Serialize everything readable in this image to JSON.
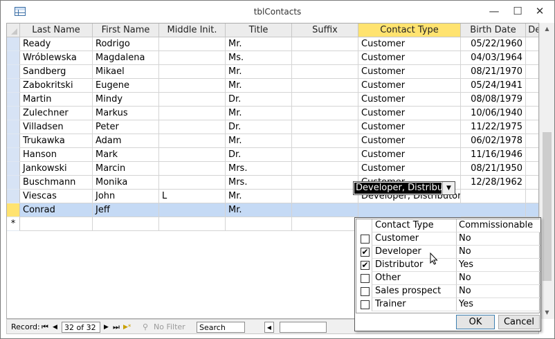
{
  "window": {
    "title": "tblContacts",
    "minimize": "—",
    "maximize": "☐",
    "close": "✕"
  },
  "columns": [
    "Last Name",
    "First Name",
    "Middle Init.",
    "Title",
    "Suffix",
    "Contact Type",
    "Birth Date",
    "Def"
  ],
  "rows": [
    [
      "Ready",
      "Rodrigo",
      "",
      "Mr.",
      "",
      "Customer",
      "05/22/1960"
    ],
    [
      "Wróblewska",
      "Magdalena",
      "",
      "Ms.",
      "",
      "Customer",
      "04/03/1964"
    ],
    [
      "Sandberg",
      "Mikael",
      "",
      "Mr.",
      "",
      "Customer",
      "08/21/1970"
    ],
    [
      "Zabokritski",
      "Eugene",
      "",
      "Mr.",
      "",
      "Customer",
      "05/24/1941"
    ],
    [
      "Martin",
      "Mindy",
      "",
      "Dr.",
      "",
      "Customer",
      "08/08/1979"
    ],
    [
      "Zulechner",
      "Markus",
      "",
      "Mr.",
      "",
      "Customer",
      "10/06/1940"
    ],
    [
      "Villadsen",
      "Peter",
      "",
      "Dr.",
      "",
      "Customer",
      "11/22/1975"
    ],
    [
      "Trukawka",
      "Adam",
      "",
      "Mr.",
      "",
      "Customer",
      "06/02/1978"
    ],
    [
      "Hanson",
      "Mark",
      "",
      "Dr.",
      "",
      "Customer",
      "11/16/1946"
    ],
    [
      "Jankowski",
      "Marcin",
      "",
      "Mrs.",
      "",
      "Customer",
      "08/21/1950"
    ],
    [
      "Buschmann",
      "Monika",
      "",
      "Mrs.",
      "",
      "Customer",
      "12/28/1962"
    ],
    [
      "Viescas",
      "John",
      "L",
      "Mr.",
      "",
      "Developer, Distributor",
      ""
    ]
  ],
  "current_row": [
    "Conrad",
    "Jeff",
    "",
    "Mr.",
    "",
    "Developer, Distributor",
    ""
  ],
  "new_row_marker": "*",
  "popup": {
    "headers": [
      "Contact Type",
      "Commissionable"
    ],
    "items": [
      {
        "label": "Customer",
        "comm": "No",
        "checked": false
      },
      {
        "label": "Developer",
        "comm": "No",
        "checked": true
      },
      {
        "label": "Distributor",
        "comm": "Yes",
        "checked": true
      },
      {
        "label": "Other",
        "comm": "No",
        "checked": false
      },
      {
        "label": "Sales prospect",
        "comm": "No",
        "checked": false
      },
      {
        "label": "Trainer",
        "comm": "Yes",
        "checked": false
      }
    ],
    "ok": "OK",
    "cancel": "Cancel"
  },
  "navbar": {
    "record_label": "Record:",
    "first": "⏮",
    "prev": "◀",
    "position": "32 of 32",
    "next": "▶",
    "last": "⏭",
    "new": "▶*",
    "filter": "No Filter",
    "search": "Search"
  }
}
